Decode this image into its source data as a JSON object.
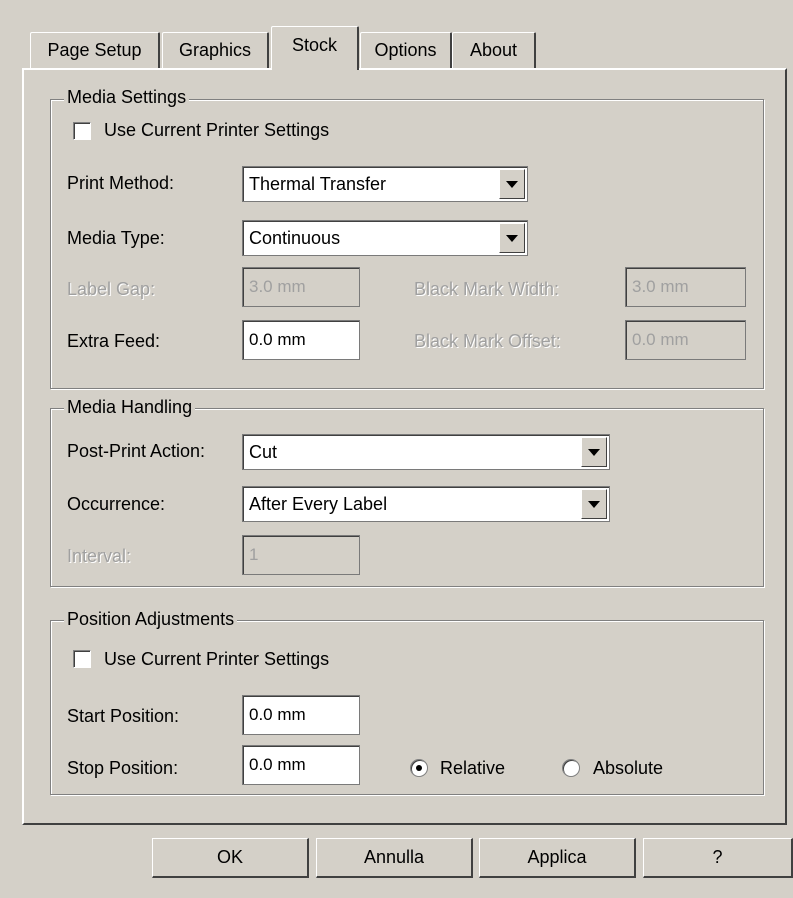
{
  "tabs": [
    "Page Setup",
    "Graphics",
    "Stock",
    "Options",
    "About"
  ],
  "active_tab": "Stock",
  "media_settings": {
    "title": "Media Settings",
    "use_current_label": "Use Current Printer Settings",
    "use_current_checked": false,
    "print_method_label": "Print Method:",
    "print_method_value": "Thermal Transfer",
    "media_type_label": "Media Type:",
    "media_type_value": "Continuous",
    "label_gap_label": "Label Gap:",
    "label_gap_value": "3.0 mm",
    "black_mark_width_label": "Black Mark Width:",
    "black_mark_width_value": "3.0 mm",
    "extra_feed_label": "Extra Feed:",
    "extra_feed_value": "0.0 mm",
    "black_mark_offset_label": "Black Mark Offset:",
    "black_mark_offset_value": "0.0 mm"
  },
  "media_handling": {
    "title": "Media Handling",
    "post_print_label": "Post-Print Action:",
    "post_print_value": "Cut",
    "occurrence_label": "Occurrence:",
    "occurrence_value": "After Every Label",
    "interval_label": "Interval:",
    "interval_value": "1"
  },
  "position_adjustments": {
    "title": "Position Adjustments",
    "use_current_label": "Use Current Printer Settings",
    "use_current_checked": false,
    "start_label": "Start Position:",
    "start_value": "0.0 mm",
    "stop_label": "Stop Position:",
    "stop_value": "0.0 mm",
    "relative_label": "Relative",
    "absolute_label": "Absolute",
    "selected_mode": "Relative"
  },
  "buttons": {
    "ok": "OK",
    "cancel": "Annulla",
    "apply": "Applica",
    "help": "?"
  }
}
